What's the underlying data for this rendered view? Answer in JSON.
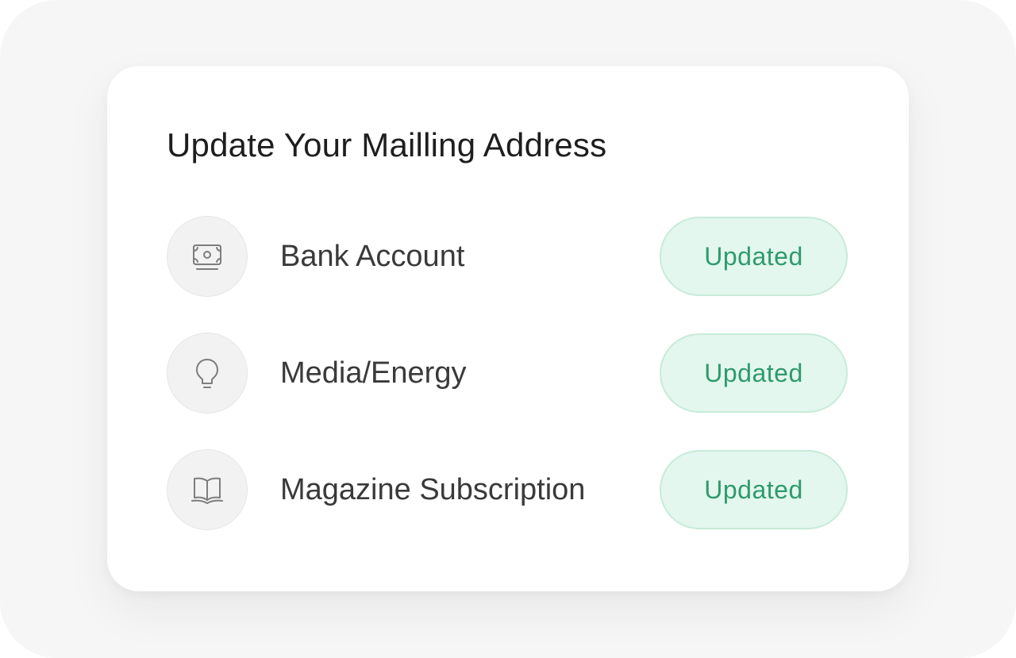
{
  "card": {
    "title": "Update Your Mailling Address"
  },
  "rows": [
    {
      "icon": "money-bill-icon",
      "label": "Bank Account",
      "status": "Updated"
    },
    {
      "icon": "lightbulb-icon",
      "label": "Media/Energy",
      "status": "Updated"
    },
    {
      "icon": "open-book-icon",
      "label": "Magazine Subscription",
      "status": "Updated"
    }
  ],
  "colors": {
    "badge_background": "#e3f7ee",
    "badge_border": "#c7ebd9",
    "badge_text": "#2f9a6c",
    "title_text": "#1e1e1e",
    "label_text": "#3a3a3a"
  }
}
